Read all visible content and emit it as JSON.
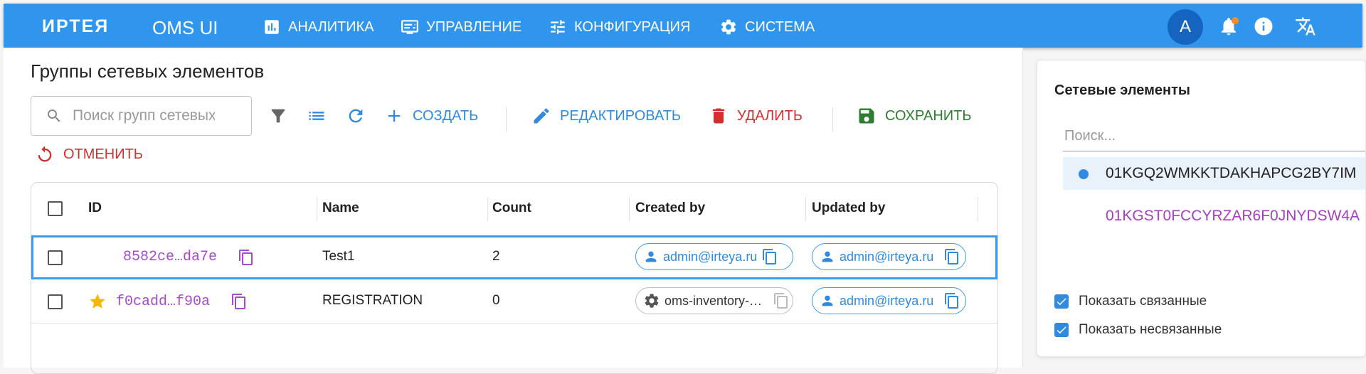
{
  "appbar": {
    "logo": "ИРТЕЯ",
    "title": "OMS UI",
    "nav": [
      "АНАЛИТИКА",
      "УПРАВЛЕНИЕ",
      "КОНФИГУРАЦИЯ",
      "СИСТЕМА"
    ],
    "avatar": "A",
    "colors": {
      "bar": "#2f95ed",
      "notification_dot": "#ff8a1e"
    },
    "icons": [
      "chart-icon",
      "management-icon",
      "sliders-icon",
      "gear-icon",
      "bell-icon",
      "info-icon",
      "translate-icon"
    ]
  },
  "page": {
    "title": "Группы сетевых элементов",
    "search_placeholder": "Поиск групп сетевых элементов"
  },
  "toolbar": {
    "create": "СОЗДАТЬ",
    "edit": "РЕДАКТИРОВАТЬ",
    "delete": "УДАЛИТЬ",
    "save": "СОХРАНИТЬ",
    "cancel": "ОТМЕНИТЬ",
    "colors": {
      "primary": "#2f8ae0",
      "danger": "#d32f2f",
      "success": "#2e7d32"
    }
  },
  "table": {
    "columns": [
      "ID",
      "Name",
      "Count",
      "Created by",
      "Updated by"
    ],
    "rows": [
      {
        "id": "8582ce…da7e",
        "name": "Test1",
        "count": "2",
        "created_by": "admin@irteya.ru",
        "updated_by": "admin@irteya.ru",
        "selected": true,
        "starred": false,
        "created_by_type": "user"
      },
      {
        "id": "f0cadd…f90a",
        "name": "REGISTRATION",
        "count": "0",
        "created_by": "oms-inventory-service",
        "updated_by": "admin@irteya.ru",
        "selected": false,
        "starred": true,
        "created_by_type": "system"
      }
    ]
  },
  "side": {
    "title": "Сетевые элементы",
    "search_placeholder": "Поиск...",
    "elements": [
      "01KGQ2WMKKTDAKHAPCG2BY7IM",
      "01KGST0FCCYRZAR6F0JNYDSW4A"
    ],
    "show_linked": "Показать связанные",
    "show_unlinked": "Показать несвязанные",
    "show_linked_checked": true,
    "show_unlinked_checked": true
  }
}
